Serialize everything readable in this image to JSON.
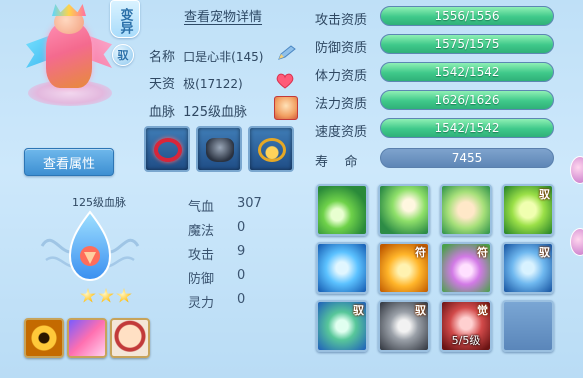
{
  "pet": {
    "mutate_label": "变异",
    "tame_label": "驭",
    "view_detail_label": "查看宠物详情",
    "view_attr_label": "查看属性",
    "name_label": "名称",
    "name_value": "口是心非(145)",
    "aptitude_label": "天资",
    "aptitude_value": "极(17122)",
    "bloodline_label": "血脉",
    "bloodline_value": "125级血脉"
  },
  "bloodline": {
    "title": "125级血脉",
    "stars": 3
  },
  "stats": [
    {
      "label": "气血",
      "value": "307"
    },
    {
      "label": "魔法",
      "value": "0"
    },
    {
      "label": "攻击",
      "value": "9"
    },
    {
      "label": "防御",
      "value": "0"
    },
    {
      "label": "灵力",
      "value": "0"
    }
  ],
  "qualifications": [
    {
      "label": "攻击资质",
      "text": "1556/1556",
      "fraction": 1.0
    },
    {
      "label": "防御资质",
      "text": "1575/1575",
      "fraction": 1.0
    },
    {
      "label": "体力资质",
      "text": "1542/1542",
      "fraction": 1.0
    },
    {
      "label": "法力资质",
      "text": "1626/1626",
      "fraction": 1.0
    },
    {
      "label": "速度资质",
      "text": "1542/1542",
      "fraction": 1.0
    }
  ],
  "lifespan": {
    "label": "寿    命",
    "value": "7455"
  },
  "skills": {
    "tag_fu": "符",
    "tag_yu": "驭",
    "tag_jue": "觉",
    "awaken_level": "5/5级"
  },
  "colors": {
    "bar_fill": "#3fc98a",
    "bar_track": "#6f97bf",
    "button": "#3d8fd2"
  }
}
